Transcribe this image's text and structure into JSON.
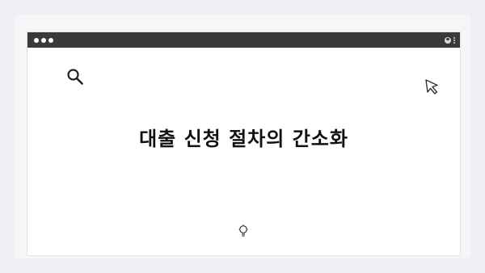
{
  "window": {
    "headline": "대출 신청 절차의 간소화"
  },
  "icons": {
    "search": "search-icon",
    "cursor": "cursor-icon",
    "lightbulb": "lightbulb-icon",
    "user": "user-icon",
    "more": "more-vertical-icon"
  },
  "colors": {
    "titlebar": "#3a3a3a",
    "page_background": "#eeeff3",
    "window_background": "#ffffff",
    "text": "#111111"
  }
}
